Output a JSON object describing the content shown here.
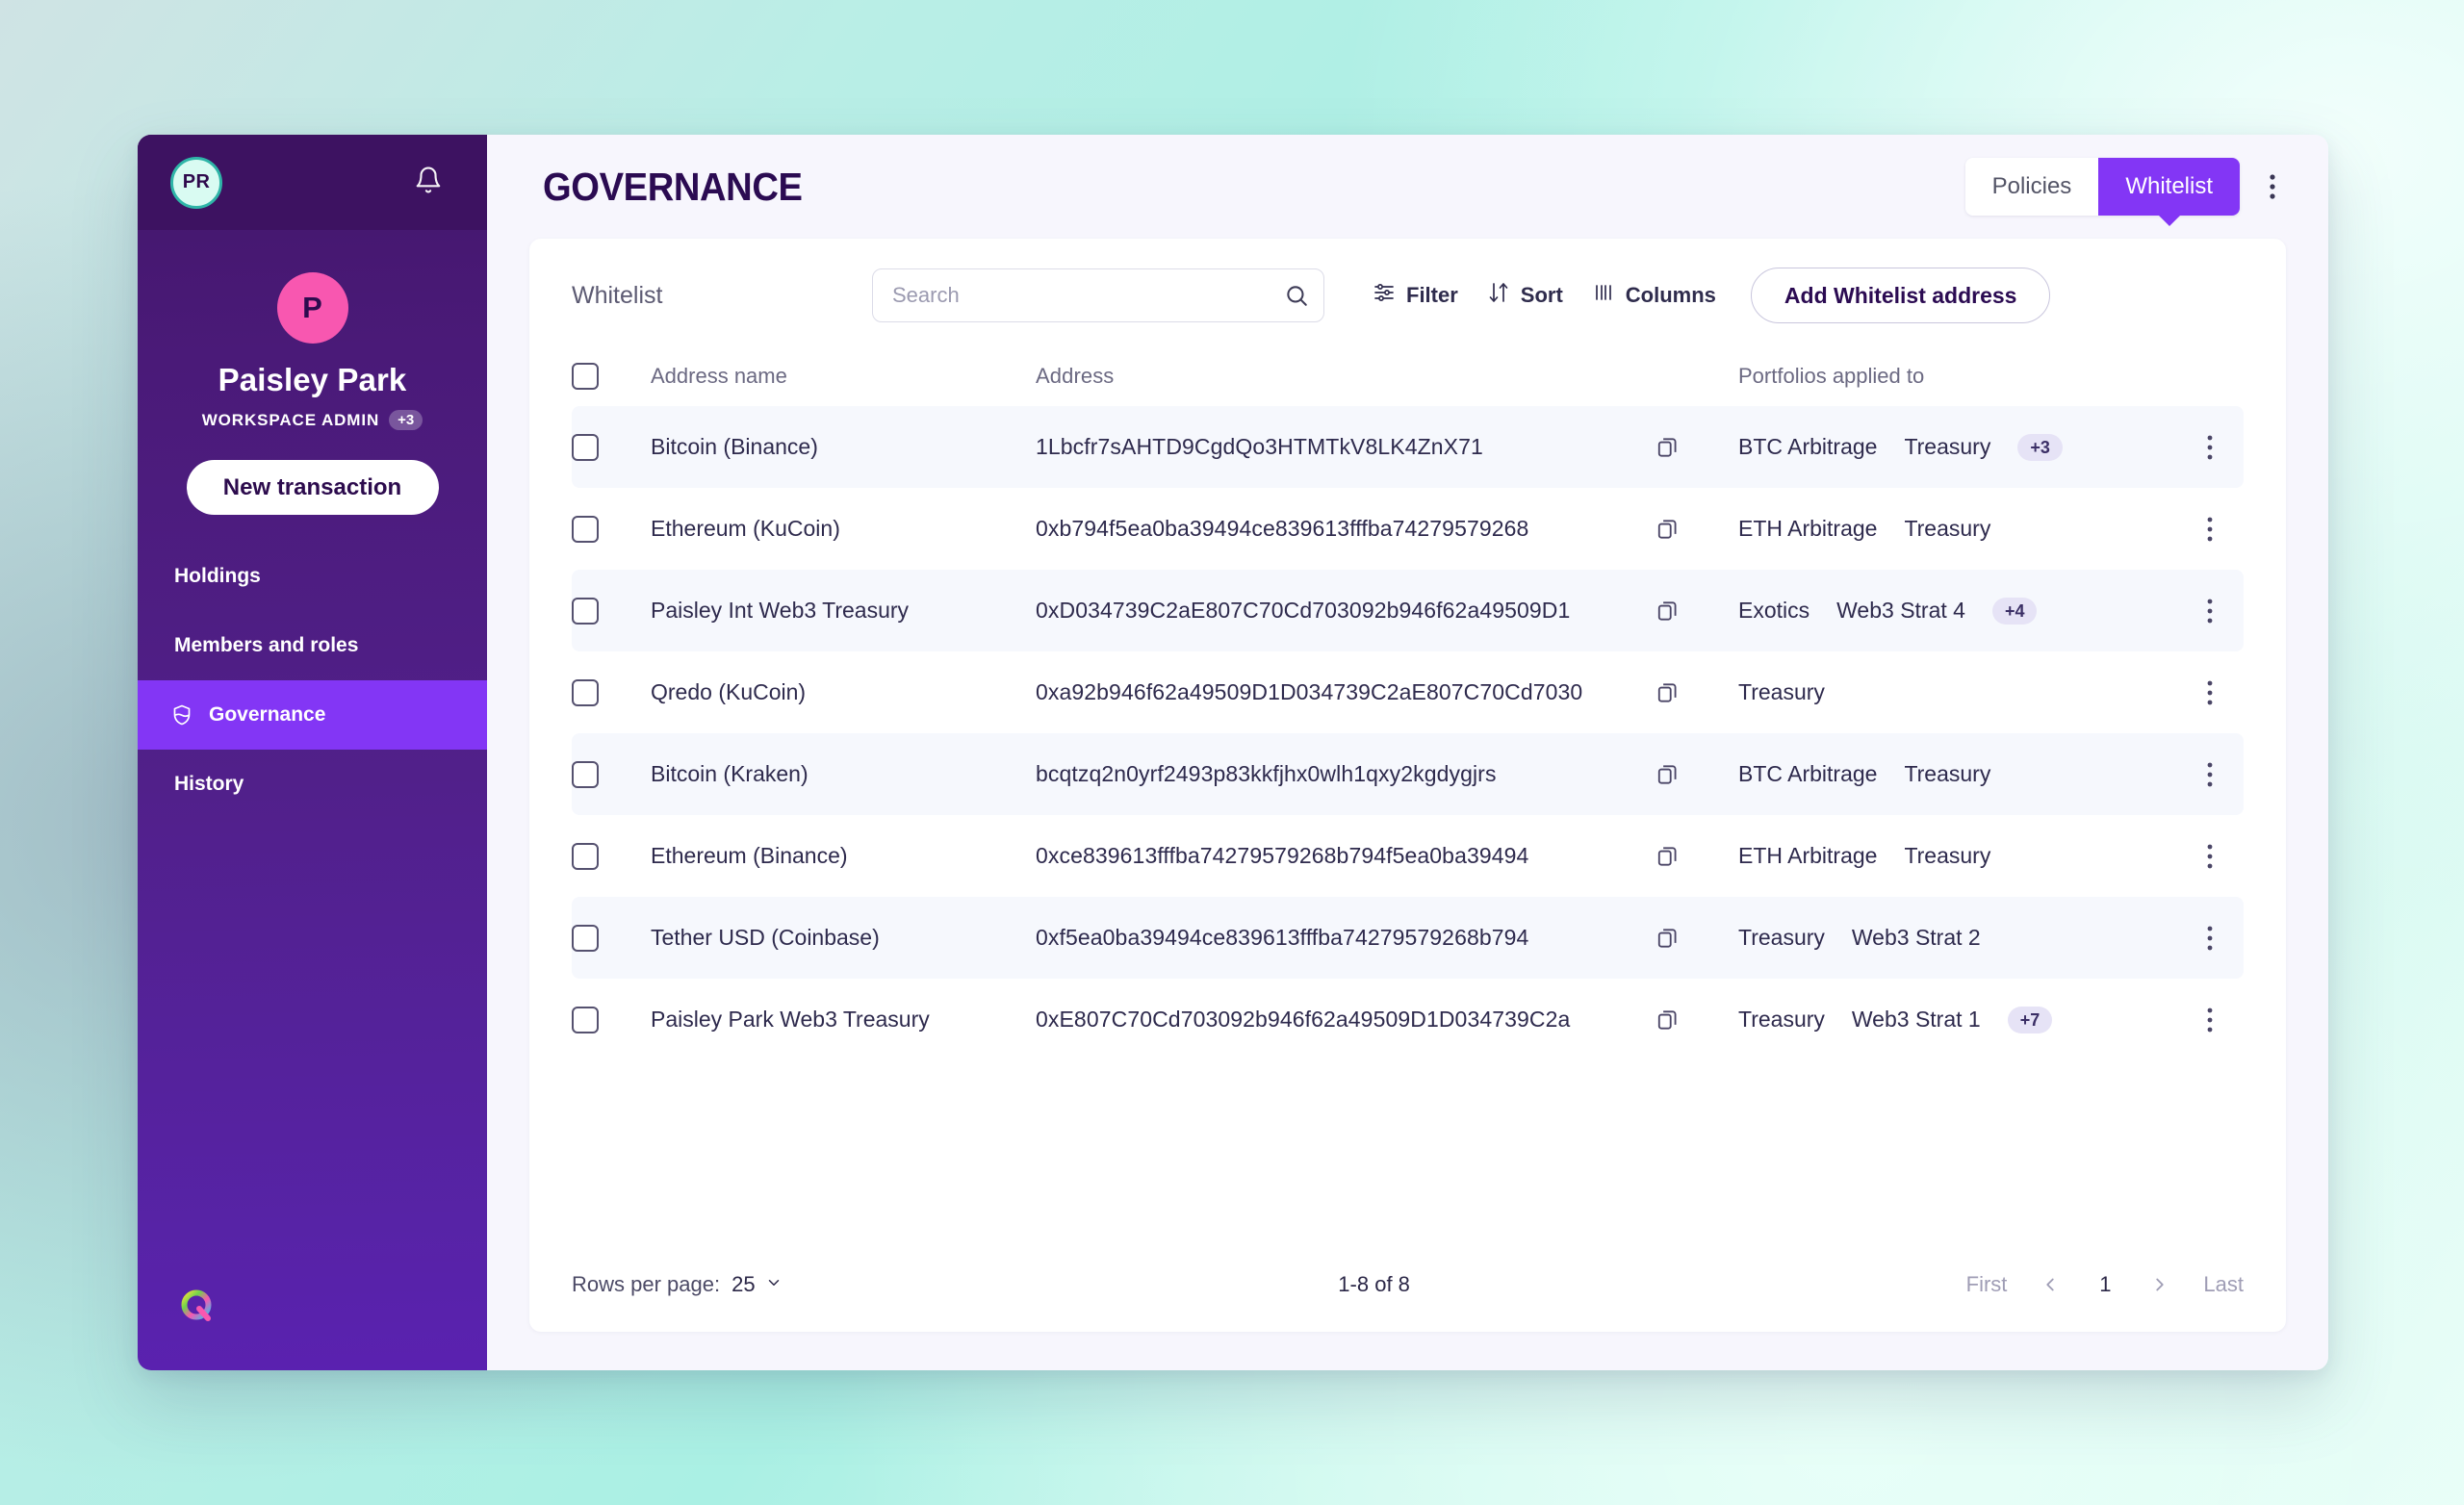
{
  "sidebar": {
    "workspace_badge": "PR",
    "bell_icon": "bell-icon",
    "avatar_initial": "P",
    "profile_name": "Paisley Park",
    "profile_role": "WORKSPACE ADMIN",
    "profile_role_more": "+3",
    "new_transaction_label": "New transaction",
    "nav_items": [
      {
        "label": "Holdings",
        "icon": "",
        "active": false
      },
      {
        "label": "Members and roles",
        "icon": "",
        "active": false
      },
      {
        "label": "Governance",
        "icon": "shield-icon",
        "active": true
      },
      {
        "label": "History",
        "icon": "",
        "active": false
      }
    ],
    "logo_name": "qredo-logo"
  },
  "header": {
    "title": "GOVERNANCE",
    "tabs": [
      {
        "label": "Policies",
        "active": false
      },
      {
        "label": "Whitelist",
        "active": true
      }
    ],
    "overflow_icon": "kebab-menu-icon"
  },
  "toolbar": {
    "title": "Whitelist",
    "search_placeholder": "Search",
    "search_value": "",
    "filter_label": "Filter",
    "sort_label": "Sort",
    "columns_label": "Columns",
    "add_label": "Add Whitelist address"
  },
  "table": {
    "columns": [
      "Address name",
      "Address",
      "Portfolios applied to"
    ],
    "rows": [
      {
        "name": "Bitcoin (Binance)",
        "address": "1Lbcfr7sAHTD9CgdQo3HTMTkV8LK4ZnX71",
        "portfolios": [
          "BTC Arbitrage",
          "Treasury"
        ],
        "more": "+3"
      },
      {
        "name": "Ethereum (KuCoin)",
        "address": "0xb794f5ea0ba39494ce839613fffba74279579268",
        "portfolios": [
          "ETH Arbitrage",
          "Treasury"
        ],
        "more": ""
      },
      {
        "name": "Paisley Int Web3 Treasury",
        "address": "0xD034739C2aE807C70Cd703092b946f62a49509D1",
        "portfolios": [
          "Exotics",
          "Web3 Strat 4"
        ],
        "more": "+4"
      },
      {
        "name": "Qredo (KuCoin)",
        "address": "0xa92b946f62a49509D1D034739C2aE807C70Cd7030",
        "portfolios": [
          "Treasury"
        ],
        "more": ""
      },
      {
        "name": "Bitcoin (Kraken)",
        "address": "bcqtzq2n0yrf2493p83kkfjhx0wlh1qxy2kgdygjrs",
        "portfolios": [
          "BTC Arbitrage",
          "Treasury"
        ],
        "more": ""
      },
      {
        "name": "Ethereum (Binance)",
        "address": "0xce839613fffba74279579268b794f5ea0ba39494",
        "portfolios": [
          "ETH Arbitrage",
          "Treasury"
        ],
        "more": ""
      },
      {
        "name": "Tether USD (Coinbase)",
        "address": "0xf5ea0ba39494ce839613fffba74279579268b794",
        "portfolios": [
          "Treasury",
          "Web3 Strat 2"
        ],
        "more": ""
      },
      {
        "name": "Paisley Park Web3 Treasury",
        "address": "0xE807C70Cd703092b946f62a49509D1D034739C2a",
        "portfolios": [
          "Treasury",
          "Web3 Strat 1"
        ],
        "more": "+7"
      }
    ]
  },
  "footer": {
    "rows_per_page_label": "Rows per page:",
    "rows_per_page_value": "25",
    "range_text": "1-8 of 8",
    "first_label": "First",
    "last_label": "Last",
    "current_page": "1"
  },
  "colors": {
    "accent_purple": "#8336f5",
    "sidebar_dark": "#3d1261",
    "avatar_pink": "#f857b0",
    "title_purple": "#2b0b52",
    "zebra_row": "#f6f8fd"
  }
}
